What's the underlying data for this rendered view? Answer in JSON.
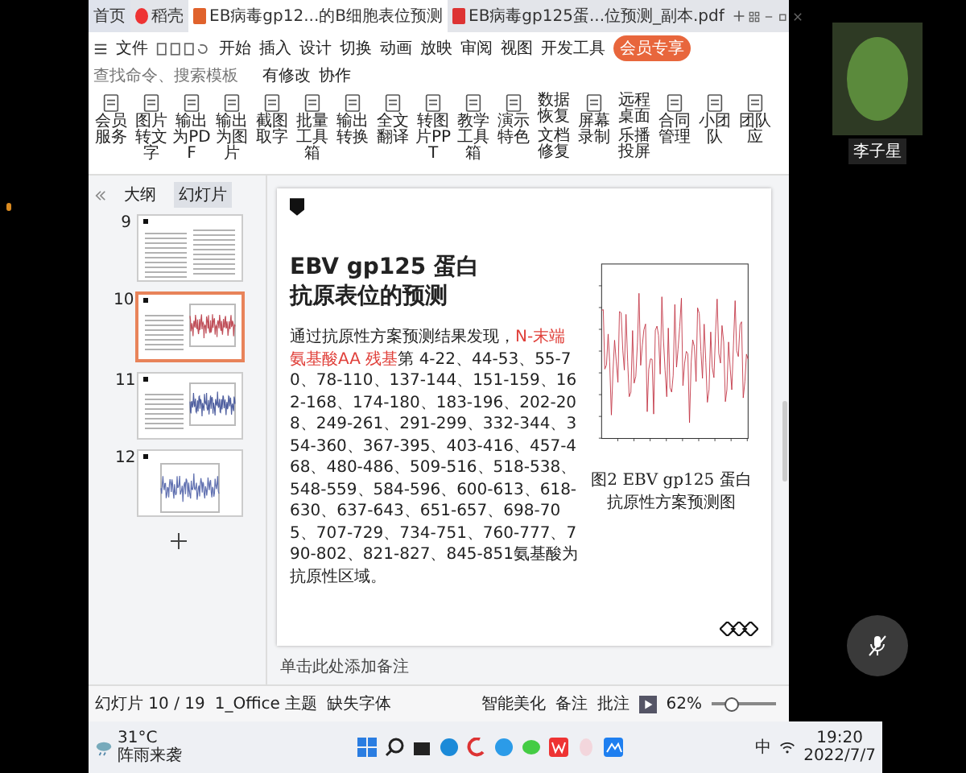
{
  "tabs": [
    {
      "label": "首页",
      "selected": false,
      "kind": "home"
    },
    {
      "label": "稻壳",
      "selected": false,
      "kind": "docer"
    },
    {
      "label": "EB病毒gp12...的B细胞表位预测",
      "selected": true,
      "kind": "doc"
    },
    {
      "label": "EB病毒gp125蛋...位预测_副本.pdf",
      "selected": false,
      "kind": "pdf"
    }
  ],
  "menu": {
    "file": "文件",
    "items": [
      "开始",
      "插入",
      "设计",
      "切换",
      "动画",
      "放映",
      "审阅",
      "视图",
      "开发工具"
    ],
    "member": "会员专享",
    "search": {
      "placeholder": "查找命令、搜索模板"
    },
    "actions": [
      "有修改",
      "协作"
    ]
  },
  "ribbon": [
    {
      "kind": "big",
      "labels": [
        "会员服务"
      ]
    },
    {
      "kind": "big",
      "labels": [
        "图片转文字"
      ]
    },
    {
      "kind": "big",
      "labels": [
        "输出为PDF"
      ]
    },
    {
      "kind": "big",
      "labels": [
        "输出为图片"
      ]
    },
    {
      "kind": "big",
      "labels": [
        "截图取字"
      ]
    },
    {
      "kind": "big",
      "labels": [
        "批量工具箱"
      ]
    },
    {
      "kind": "big",
      "labels": [
        "输出转换"
      ]
    },
    {
      "kind": "big",
      "labels": [
        "全文翻译"
      ]
    },
    {
      "kind": "big",
      "labels": [
        "转图片PPT"
      ]
    },
    {
      "kind": "big",
      "labels": [
        "教学工具箱"
      ]
    },
    {
      "kind": "big",
      "labels": [
        "演示特色"
      ]
    },
    {
      "kind": "stack",
      "labels": [
        "数据恢复",
        "文档修复"
      ]
    },
    {
      "kind": "big",
      "labels": [
        "屏幕录制"
      ]
    },
    {
      "kind": "stack",
      "labels": [
        "远程桌面",
        "乐播投屏"
      ]
    },
    {
      "kind": "big",
      "labels": [
        "合同管理"
      ]
    },
    {
      "kind": "big",
      "labels": [
        "小团队"
      ]
    },
    {
      "kind": "big",
      "labels": [
        "团队应"
      ]
    }
  ],
  "sidebar": {
    "tabs": [
      {
        "label": "大纲",
        "selected": false
      },
      {
        "label": "幻灯片",
        "selected": true
      }
    ],
    "thumbnails": [
      {
        "number": "9",
        "selected": false,
        "kind": "text"
      },
      {
        "number": "10",
        "selected": true,
        "kind": "red-chart"
      },
      {
        "number": "11",
        "selected": false,
        "kind": "blue-chart"
      },
      {
        "number": "12",
        "selected": false,
        "kind": "full-chart"
      }
    ]
  },
  "slide": {
    "title": [
      "EBV gp125 蛋白",
      "抗原表位的预测"
    ],
    "body": [
      {
        "kind": "normal",
        "text": "通过抗原性方案预测结果发现，"
      },
      {
        "kind": "highlight",
        "text": "N-末端氨基酸AA 残基"
      },
      {
        "kind": "normal",
        "text": "第 4-22、44-53、55-70、78-110、137-144、151-159、162-168、174-180、183-196、202-208、249-261、291-299、332-344、354-360、367-395、403-416、457-468、480-486、509-516、518-538、548-559、584-596、600-613、618-630、637-643、651-657、698-705、707-729、734-751、760-777、790-802、821-827、845-851氨基酸为抗原性区域。"
      }
    ],
    "caption": "图2  EBV gp125 蛋白抗原性方案预测图"
  },
  "notes": {
    "placeholder": "单击此处添加备注"
  },
  "status": {
    "slide": "幻灯片 10 / 19",
    "theme": "1_Office 主题",
    "font": "缺失字体",
    "beautify": "智能美化",
    "notes": "备注",
    "comments": "批注",
    "zoom": "62%",
    "level": 0.3
  },
  "taskbar": {
    "temp": "31°C",
    "weather": "阵雨来袭",
    "ime": "中",
    "time": "19:20",
    "date": "2022/7/7"
  },
  "video": {
    "name": "李子星"
  }
}
